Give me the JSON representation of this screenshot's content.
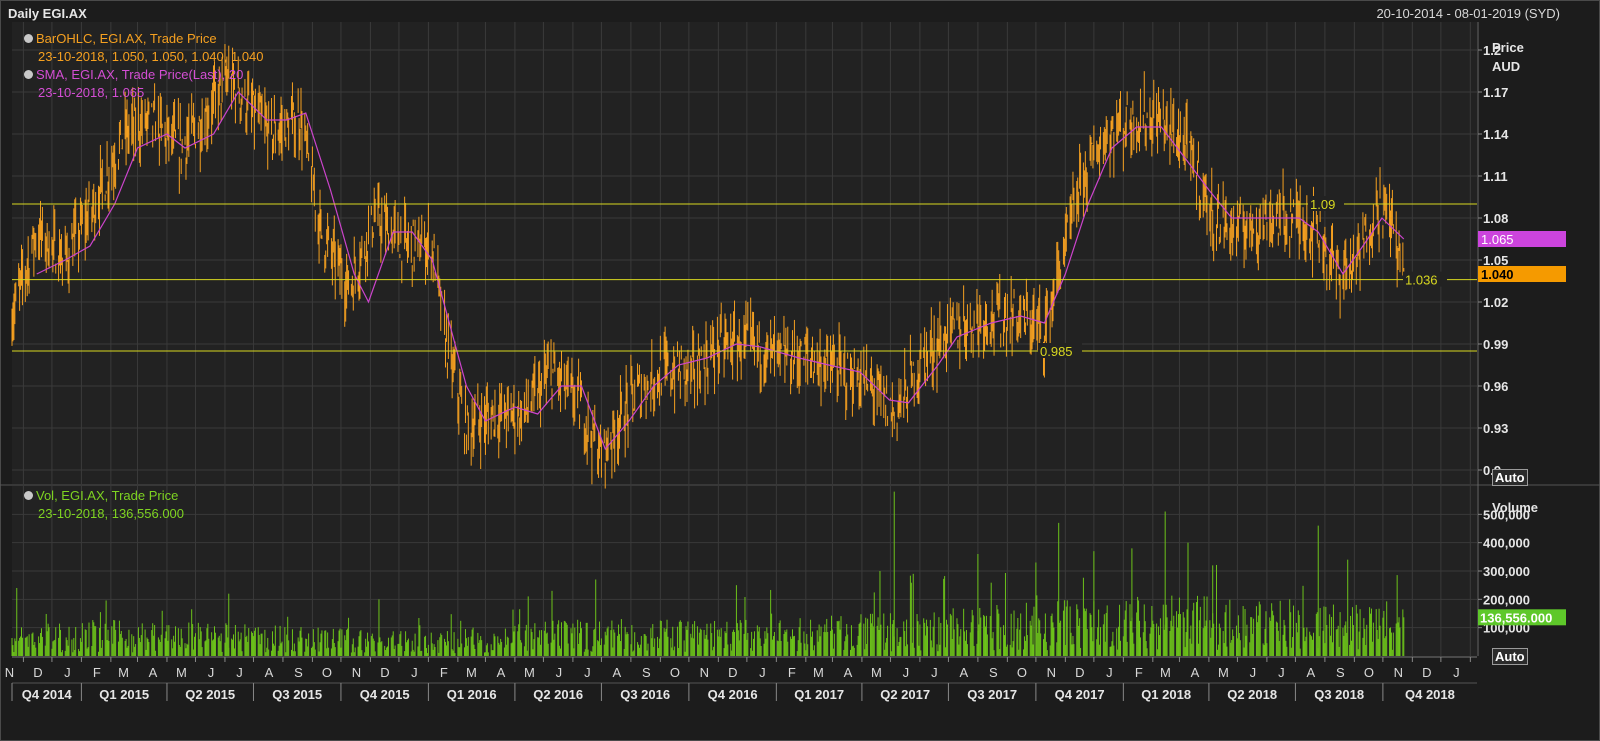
{
  "header": {
    "title": "Daily EGI.AX",
    "date_range": "20-10-2014 - 08-01-2019 (SYD)"
  },
  "price_legend": {
    "ohlc_name": "BarOHLC, EGI.AX, Trade Price",
    "ohlc_values": "23-10-2018, 1.050, 1.050, 1.040, 1.040",
    "sma_name": "SMA, EGI.AX, Trade Price(Last),  20",
    "sma_values": "23-10-2018, 1.065"
  },
  "volume_legend": {
    "name": "Vol, EGI.AX, Trade Price",
    "values": "23-10-2018, 136,556.000"
  },
  "price_axis": {
    "title_line1": "Price",
    "title_line2": "AUD",
    "auto_label": "Auto"
  },
  "volume_axis": {
    "title": "Volume",
    "auto_label": "Auto"
  },
  "colors": {
    "bars": "#f5a020",
    "sma": "#cc44cc",
    "volume": "#6cc21a",
    "hline": "#d8d820",
    "grid": "#3a3a3a",
    "last_price_bg": "#f59a00",
    "sma_badge_bg": "#cc44dd",
    "vol_badge_bg": "#5ec82a"
  },
  "chart_data": [
    {
      "type": "line",
      "title": "Daily EGI.AX",
      "ylabel": "Price AUD",
      "ylim": [
        0.89,
        1.22
      ],
      "yticks": [
        0.9,
        0.93,
        0.96,
        0.99,
        1.02,
        1.05,
        1.08,
        1.11,
        1.14,
        1.17,
        1.2
      ],
      "ytick_labels": [
        "0.9",
        "0.93",
        "0.96",
        "0.99",
        "1.02",
        "1.05",
        "1.08",
        "1.11",
        "1.14",
        "1.17",
        "1.2"
      ],
      "grid": true,
      "x_start": "2014-10-20",
      "x_end": "2019-01-08",
      "series": [
        {
          "name": "BarOHLC, EGI.AX, Trade Price",
          "style": "ohlc-bars",
          "points": [
            [
              "2014-10-20",
              1.01
            ],
            [
              "2014-11-15",
              1.07
            ],
            [
              "2014-12-15",
              1.05
            ],
            [
              "2015-01-15",
              1.09
            ],
            [
              "2015-02-15",
              1.14
            ],
            [
              "2015-03-15",
              1.15
            ],
            [
              "2015-04-15",
              1.13
            ],
            [
              "2015-05-10",
              1.15
            ],
            [
              "2015-06-05",
              1.18
            ],
            [
              "2015-06-25",
              1.16
            ],
            [
              "2015-07-20",
              1.14
            ],
            [
              "2015-08-20",
              1.15
            ],
            [
              "2015-09-10",
              1.07
            ],
            [
              "2015-10-10",
              1.03
            ],
            [
              "2015-11-05",
              1.08
            ],
            [
              "2015-12-10",
              1.06
            ],
            [
              "2016-01-05",
              1.06
            ],
            [
              "2016-01-20",
              0.99
            ],
            [
              "2016-02-10",
              0.93
            ],
            [
              "2016-03-10",
              0.94
            ],
            [
              "2016-04-10",
              0.94
            ],
            [
              "2016-05-10",
              0.97
            ],
            [
              "2016-06-05",
              0.95
            ],
            [
              "2016-07-01",
              0.91
            ],
            [
              "2016-08-01",
              0.95
            ],
            [
              "2016-09-01",
              0.97
            ],
            [
              "2016-10-05",
              0.97
            ],
            [
              "2016-11-05",
              0.99
            ],
            [
              "2016-12-05",
              0.99
            ],
            [
              "2017-01-05",
              0.98
            ],
            [
              "2017-02-05",
              0.98
            ],
            [
              "2017-03-10",
              0.97
            ],
            [
              "2017-04-10",
              0.96
            ],
            [
              "2017-05-05",
              0.94
            ],
            [
              "2017-06-05",
              0.98
            ],
            [
              "2017-07-05",
              1.0
            ],
            [
              "2017-08-10",
              1.01
            ],
            [
              "2017-09-10",
              1.01
            ],
            [
              "2017-10-10",
              1.0
            ],
            [
              "2017-11-01",
              1.06
            ],
            [
              "2017-11-20",
              1.11
            ],
            [
              "2017-12-15",
              1.14
            ],
            [
              "2018-01-10",
              1.15
            ],
            [
              "2018-02-10",
              1.15
            ],
            [
              "2018-03-10",
              1.13
            ],
            [
              "2018-04-05",
              1.08
            ],
            [
              "2018-05-01",
              1.07
            ],
            [
              "2018-06-05",
              1.08
            ],
            [
              "2018-07-01",
              1.08
            ],
            [
              "2018-07-25",
              1.07
            ],
            [
              "2018-08-15",
              1.04
            ],
            [
              "2018-09-05",
              1.05
            ],
            [
              "2018-09-25",
              1.09
            ],
            [
              "2018-10-10",
              1.08
            ],
            [
              "2018-10-23",
              1.04
            ]
          ]
        },
        {
          "name": "SMA, EGI.AX, Trade Price(Last),  20",
          "style": "line",
          "points": [
            [
              "2014-11-15",
              1.04
            ],
            [
              "2014-12-15",
              1.05
            ],
            [
              "2015-01-10",
              1.06
            ],
            [
              "2015-02-05",
              1.09
            ],
            [
              "2015-03-01",
              1.13
            ],
            [
              "2015-04-01",
              1.14
            ],
            [
              "2015-04-20",
              1.13
            ],
            [
              "2015-05-20",
              1.14
            ],
            [
              "2015-06-15",
              1.17
            ],
            [
              "2015-07-15",
              1.15
            ],
            [
              "2015-08-05",
              1.15
            ],
            [
              "2015-08-25",
              1.155
            ],
            [
              "2015-09-20",
              1.1
            ],
            [
              "2015-10-15",
              1.04
            ],
            [
              "2015-10-30",
              1.02
            ],
            [
              "2015-11-25",
              1.07
            ],
            [
              "2015-12-15",
              1.07
            ],
            [
              "2016-01-05",
              1.05
            ],
            [
              "2016-02-10",
              0.96
            ],
            [
              "2016-03-01",
              0.935
            ],
            [
              "2016-04-01",
              0.945
            ],
            [
              "2016-04-25",
              0.94
            ],
            [
              "2016-05-20",
              0.96
            ],
            [
              "2016-06-10",
              0.96
            ],
            [
              "2016-07-05",
              0.915
            ],
            [
              "2016-07-30",
              0.935
            ],
            [
              "2016-08-25",
              0.96
            ],
            [
              "2016-09-20",
              0.975
            ],
            [
              "2016-10-20",
              0.98
            ],
            [
              "2016-11-20",
              0.99
            ],
            [
              "2016-12-15",
              0.988
            ],
            [
              "2017-01-25",
              0.98
            ],
            [
              "2017-02-25",
              0.975
            ],
            [
              "2017-03-30",
              0.97
            ],
            [
              "2017-04-30",
              0.95
            ],
            [
              "2017-05-20",
              0.948
            ],
            [
              "2017-06-20",
              0.975
            ],
            [
              "2017-07-10",
              0.995
            ],
            [
              "2017-08-15",
              1.005
            ],
            [
              "2017-09-15",
              1.01
            ],
            [
              "2017-10-10",
              1.005
            ],
            [
              "2017-11-01",
              1.04
            ],
            [
              "2017-11-25",
              1.09
            ],
            [
              "2017-12-20",
              1.13
            ],
            [
              "2018-01-15",
              1.145
            ],
            [
              "2018-02-10",
              1.145
            ],
            [
              "2018-03-10",
              1.12
            ],
            [
              "2018-04-01",
              1.1
            ],
            [
              "2018-04-25",
              1.08
            ],
            [
              "2018-06-01",
              1.08
            ],
            [
              "2018-07-05",
              1.08
            ],
            [
              "2018-07-25",
              1.07
            ],
            [
              "2018-08-20",
              1.04
            ],
            [
              "2018-09-10",
              1.06
            ],
            [
              "2018-09-30",
              1.08
            ],
            [
              "2018-10-23",
              1.065
            ]
          ]
        }
      ],
      "hlines": [
        {
          "value": 1.09,
          "label": "1.09"
        },
        {
          "value": 1.036,
          "label": "1.036"
        },
        {
          "value": 0.985,
          "label": "0.985"
        }
      ],
      "last_values": {
        "sma": "1.065",
        "close": "1.040"
      }
    },
    {
      "type": "bar",
      "ylabel": "Volume",
      "ylim": [
        0,
        600000
      ],
      "yticks": [
        100000,
        200000,
        300000,
        400000,
        500000
      ],
      "ytick_labels": [
        "100,000",
        "200,000",
        "300,000",
        "400,000",
        "500,000"
      ],
      "grid": true,
      "series": [
        {
          "name": "Vol, EGI.AX, Trade Price",
          "style": "daily-volume",
          "profile": [
            [
              "2014-10-20",
              70000
            ],
            [
              "2015-01-01",
              90000
            ],
            [
              "2015-06-01",
              80000
            ],
            [
              "2016-01-01",
              60000
            ],
            [
              "2016-06-01",
              90000
            ],
            [
              "2017-01-01",
              90000
            ],
            [
              "2017-06-01",
              110000
            ],
            [
              "2017-11-01",
              140000
            ],
            [
              "2018-03-01",
              150000
            ],
            [
              "2018-10-23",
              120000
            ]
          ],
          "spikes": [
            [
              "2014-10-25",
              240000
            ],
            [
              "2015-06-05",
              220000
            ],
            [
              "2015-11-10",
              200000
            ],
            [
              "2016-05-10",
              230000
            ],
            [
              "2016-06-25",
              270000
            ],
            [
              "2016-11-20",
              250000
            ],
            [
              "2017-04-20",
              300000
            ],
            [
              "2017-05-05",
              580000
            ],
            [
              "2017-05-25",
              290000
            ],
            [
              "2017-08-01",
              360000
            ],
            [
              "2017-10-01",
              330000
            ],
            [
              "2017-10-25",
              470000
            ],
            [
              "2017-12-01",
              370000
            ],
            [
              "2018-01-10",
              380000
            ],
            [
              "2018-02-14",
              510000
            ],
            [
              "2018-03-10",
              400000
            ],
            [
              "2018-04-05",
              320000
            ],
            [
              "2018-07-25",
              460000
            ],
            [
              "2018-08-25",
              340000
            ]
          ],
          "last": [
            "2018-10-23",
            136556
          ]
        }
      ],
      "last_value": "136,556.000"
    }
  ],
  "x_axis": {
    "months": [
      {
        "date": "2014-11-01",
        "label": "N"
      },
      {
        "date": "2014-12-01",
        "label": "D"
      },
      {
        "date": "2015-01-01",
        "label": "J"
      },
      {
        "date": "2015-02-01",
        "label": "F"
      },
      {
        "date": "2015-03-01",
        "label": "M"
      },
      {
        "date": "2015-04-01",
        "label": "A"
      },
      {
        "date": "2015-05-01",
        "label": "M"
      },
      {
        "date": "2015-06-01",
        "label": "J"
      },
      {
        "date": "2015-07-01",
        "label": "J"
      },
      {
        "date": "2015-08-01",
        "label": "A"
      },
      {
        "date": "2015-09-01",
        "label": "S"
      },
      {
        "date": "2015-10-01",
        "label": "O"
      },
      {
        "date": "2015-11-01",
        "label": "N"
      },
      {
        "date": "2015-12-01",
        "label": "D"
      },
      {
        "date": "2016-01-01",
        "label": "J"
      },
      {
        "date": "2016-02-01",
        "label": "F"
      },
      {
        "date": "2016-03-01",
        "label": "M"
      },
      {
        "date": "2016-04-01",
        "label": "A"
      },
      {
        "date": "2016-05-01",
        "label": "M"
      },
      {
        "date": "2016-06-01",
        "label": "J"
      },
      {
        "date": "2016-07-01",
        "label": "J"
      },
      {
        "date": "2016-08-01",
        "label": "A"
      },
      {
        "date": "2016-09-01",
        "label": "S"
      },
      {
        "date": "2016-10-01",
        "label": "O"
      },
      {
        "date": "2016-11-01",
        "label": "N"
      },
      {
        "date": "2016-12-01",
        "label": "D"
      },
      {
        "date": "2017-01-01",
        "label": "J"
      },
      {
        "date": "2017-02-01",
        "label": "F"
      },
      {
        "date": "2017-03-01",
        "label": "M"
      },
      {
        "date": "2017-04-01",
        "label": "A"
      },
      {
        "date": "2017-05-01",
        "label": "M"
      },
      {
        "date": "2017-06-01",
        "label": "J"
      },
      {
        "date": "2017-07-01",
        "label": "J"
      },
      {
        "date": "2017-08-01",
        "label": "A"
      },
      {
        "date": "2017-09-01",
        "label": "S"
      },
      {
        "date": "2017-10-01",
        "label": "O"
      },
      {
        "date": "2017-11-01",
        "label": "N"
      },
      {
        "date": "2017-12-01",
        "label": "D"
      },
      {
        "date": "2018-01-01",
        "label": "J"
      },
      {
        "date": "2018-02-01",
        "label": "F"
      },
      {
        "date": "2018-03-01",
        "label": "M"
      },
      {
        "date": "2018-04-01",
        "label": "A"
      },
      {
        "date": "2018-05-01",
        "label": "M"
      },
      {
        "date": "2018-06-01",
        "label": "J"
      },
      {
        "date": "2018-07-01",
        "label": "J"
      },
      {
        "date": "2018-08-01",
        "label": "A"
      },
      {
        "date": "2018-09-01",
        "label": "S"
      },
      {
        "date": "2018-10-01",
        "label": "O"
      },
      {
        "date": "2018-11-01",
        "label": "N"
      },
      {
        "date": "2018-12-01",
        "label": "D"
      },
      {
        "date": "2019-01-01",
        "label": "J"
      }
    ],
    "quarters": [
      {
        "start": "2014-10-20",
        "end": "2015-01-01",
        "label": "Q4 2014"
      },
      {
        "start": "2015-01-01",
        "end": "2015-04-01",
        "label": "Q1 2015"
      },
      {
        "start": "2015-04-01",
        "end": "2015-07-01",
        "label": "Q2 2015"
      },
      {
        "start": "2015-07-01",
        "end": "2015-10-01",
        "label": "Q3 2015"
      },
      {
        "start": "2015-10-01",
        "end": "2016-01-01",
        "label": "Q4 2015"
      },
      {
        "start": "2016-01-01",
        "end": "2016-04-01",
        "label": "Q1 2016"
      },
      {
        "start": "2016-04-01",
        "end": "2016-07-01",
        "label": "Q2 2016"
      },
      {
        "start": "2016-07-01",
        "end": "2016-10-01",
        "label": "Q3 2016"
      },
      {
        "start": "2016-10-01",
        "end": "2017-01-01",
        "label": "Q4 2016"
      },
      {
        "start": "2017-01-01",
        "end": "2017-04-01",
        "label": "Q1 2017"
      },
      {
        "start": "2017-04-01",
        "end": "2017-07-01",
        "label": "Q2 2017"
      },
      {
        "start": "2017-07-01",
        "end": "2017-10-01",
        "label": "Q3 2017"
      },
      {
        "start": "2017-10-01",
        "end": "2018-01-01",
        "label": "Q4 2017"
      },
      {
        "start": "2018-01-01",
        "end": "2018-04-01",
        "label": "Q1 2018"
      },
      {
        "start": "2018-04-01",
        "end": "2018-07-01",
        "label": "Q2 2018"
      },
      {
        "start": "2018-07-01",
        "end": "2018-10-01",
        "label": "Q3 2018"
      },
      {
        "start": "2018-10-01",
        "end": "2019-01-08",
        "label": "Q4 2018"
      }
    ]
  }
}
